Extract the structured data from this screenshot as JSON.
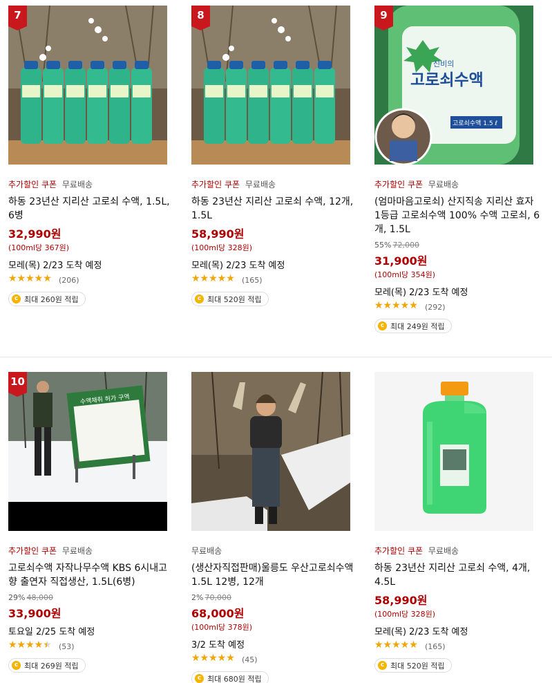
{
  "colors": {
    "accent": "#ae0000",
    "rank_badge": "#c8181e",
    "star": "#f2a600",
    "coin": "#f5b400"
  },
  "products": [
    {
      "rank": "7",
      "image_icon": "bottles-photo",
      "coupon": "추가할인 쿠폰",
      "free_shipping": "무료배송",
      "title": "하동 23년산 지리산 고로쇠 수액, 1.5L, 6병",
      "discount_rate": "",
      "original_price": "",
      "price": "32,990원",
      "unit_price": "(100ml당 367원)",
      "delivery": "모레(목) 2/23 도착 예정",
      "rating": 4.5,
      "review_count": "(206)",
      "reward": "최대 260원 적립"
    },
    {
      "rank": "8",
      "image_icon": "bottles-photo",
      "coupon": "추가할인 쿠폰",
      "free_shipping": "무료배송",
      "title": "하동 23년산 지리산 고로쇠 수액, 12개, 1.5L",
      "discount_rate": "",
      "original_price": "",
      "price": "58,990원",
      "unit_price": "(100ml당 328원)",
      "delivery": "모레(목) 2/23 도착 예정",
      "rating": 4.5,
      "review_count": "(165)",
      "reward": "최대 520원 적립"
    },
    {
      "rank": "9",
      "image_icon": "bottle-closeup-photo",
      "coupon": "추가할인 쿠폰",
      "free_shipping": "무료배송",
      "title": "(엄마마음고로쇠) 산지직송 지리산 효자 1등급 고로쇠수액 100% 수액 고로쇠, 6개, 1.5L",
      "discount_rate": "55%",
      "original_price": "72,000",
      "price": "31,900원",
      "unit_price": "(100ml당 354원)",
      "delivery": "모레(목) 2/23 도착 예정",
      "rating": 4.5,
      "review_count": "(292)",
      "reward": "최대 249원 적립",
      "image_text": {
        "brand": "신비의",
        "name": "고로쇠수액",
        "tag": "고로쇠수액 1.5 ℓ"
      }
    },
    {
      "rank": "10",
      "image_icon": "sign-photo",
      "coupon": "추가할인 쿠폰",
      "free_shipping": "무료배송",
      "title": "고로쇠수액 자작나무수액 KBS 6시내고향 출연자 직접생산, 1.5L(6병)",
      "discount_rate": "29%",
      "original_price": "48,000",
      "price": "33,900원",
      "unit_price": "",
      "delivery": "토요일 2/25 도착 예정",
      "rating": 4.0,
      "review_count": "(53)",
      "reward": "최대 269원 적립",
      "image_text": {
        "sign": "수액채취 허가 구역"
      }
    },
    {
      "rank": "",
      "image_icon": "man-snow-photo",
      "coupon": "",
      "free_shipping": "무료배송",
      "title": "(생산자직접판매)울릉도 우산고로쇠수액 1.5L 12병, 12개",
      "discount_rate": "2%",
      "original_price": "70,000",
      "price": "68,000원",
      "unit_price": "(100ml당 378원)",
      "delivery": "3/2 도착 예정",
      "rating": 5.0,
      "review_count": "(45)",
      "reward": "최대 680원 적립"
    },
    {
      "rank": "",
      "image_icon": "jug-photo",
      "coupon": "추가할인 쿠폰",
      "free_shipping": "무료배송",
      "title": "하동 23년산 지리산 고로쇠 수액, 4개, 4.5L",
      "discount_rate": "",
      "original_price": "",
      "price": "58,990원",
      "unit_price": "(100ml당 328원)",
      "delivery": "모레(목) 2/23 도착 예정",
      "rating": 4.5,
      "review_count": "(165)",
      "reward": "최대 520원 적립"
    }
  ]
}
